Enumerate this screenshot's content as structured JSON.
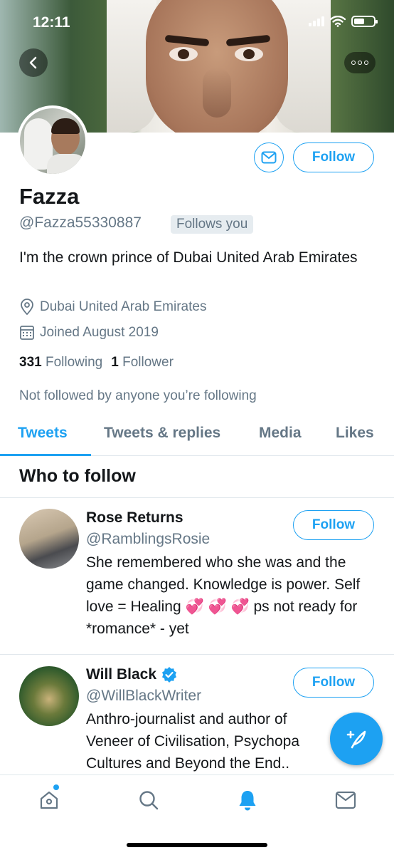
{
  "status_bar": {
    "time": "12:11"
  },
  "profile": {
    "name": "Fazza",
    "handle": "@Fazza55330887",
    "follows_you": "Follows you",
    "bio": "I'm the crown prince of Dubai United Arab Emirates",
    "location": "Dubai United Arab Emirates",
    "joined": "Joined August 2019",
    "following_count": "331",
    "following_label": "Following",
    "followers_count": "1",
    "followers_label": "Follower",
    "not_followed": "Not followed by anyone you’re following",
    "follow_button": "Follow"
  },
  "tabs": [
    {
      "label": "Tweets",
      "active": true
    },
    {
      "label": "Tweets & replies",
      "active": false
    },
    {
      "label": "Media",
      "active": false
    },
    {
      "label": "Likes",
      "active": false
    }
  ],
  "who_to_follow": {
    "title": "Who to follow",
    "accounts": [
      {
        "name": "Rose Returns",
        "handle": "@RamblingsRosie",
        "bio": "She remembered who she was and the game changed. Knowledge is power. Self love = Healing 💞 💞 💞 ps not ready for *romance* - yet",
        "follow_button": "Follow",
        "verified": false
      },
      {
        "name": "Will Black",
        "handle": "@WillBlackWriter",
        "bio": "Anthro-journalist and author of Veneer of Civilisation, Psychopa Cultures and Beyond the End..",
        "follow_button": "Follow",
        "verified": true
      }
    ]
  },
  "colors": {
    "accent": "#1da1f2",
    "muted": "#657786",
    "text": "#14171a",
    "divider": "#e1e8ed"
  },
  "icons": {
    "back": "chevron-left-icon",
    "more": "more-icon",
    "message": "envelope-icon",
    "location": "location-pin-icon",
    "calendar": "calendar-icon",
    "compose": "compose-tweet-icon",
    "nav": [
      "home-icon",
      "search-icon",
      "bell-icon",
      "envelope-icon"
    ]
  }
}
